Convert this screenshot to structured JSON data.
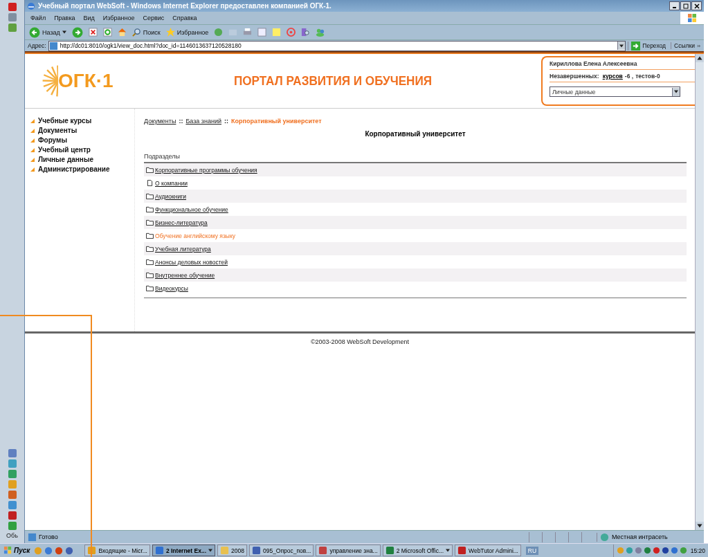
{
  "window": {
    "title": "Учебный портал WebSoft - Windows Internet Explorer предоставлен компанией  ОГК-1."
  },
  "menu": [
    "Файл",
    "Правка",
    "Вид",
    "Избранное",
    "Сервис",
    "Справка"
  ],
  "toolbar": {
    "back": "Назад",
    "search": "Поиск",
    "favorites": "Избранное"
  },
  "address": {
    "label": "Адрес:",
    "value": "http://dc01:8010/ogk1/view_doc.html?doc_id=1146013637120528180",
    "go": "Переход",
    "links": "Ссылки"
  },
  "header": {
    "title": "ПОРТАЛ РАЗВИТИЯ И ОБУЧЕНИЯ",
    "user": "Кириллова Елена Алексеевна",
    "pending_label": "Незавершенных:",
    "courses_link": "курсов",
    "courses_count": "-6 ,",
    "tests": "тестов-0",
    "select": "Личные данные"
  },
  "sidebar": {
    "items": [
      "Учебные курсы",
      "Документы",
      "Форумы",
      "Учебный центр",
      "Личные данные",
      "Администрирование"
    ]
  },
  "logo_text": "ОГК·1",
  "breadcrumb": [
    {
      "label": "Документы",
      "current": false
    },
    {
      "separator": "::",
      "label": "База знаний",
      "current": false
    },
    {
      "separator": "::",
      "label": "Корпоративный университет",
      "current": true
    }
  ],
  "page_title": "Корпоративный университет",
  "section_label": "Подразделы",
  "subsections": [
    {
      "label": "Корпоративные программы обучения",
      "kind": "folder",
      "highlighted": false
    },
    {
      "label": "О компании",
      "kind": "document",
      "highlighted": false
    },
    {
      "label": "Аудиокниги",
      "kind": "folder",
      "highlighted": false
    },
    {
      "label": "Функциональное обучение",
      "kind": "folder",
      "highlighted": false
    },
    {
      "label": "Бизнес-литература",
      "kind": "folder",
      "highlighted": false
    },
    {
      "label": "Обучение английскому языку",
      "kind": "folder",
      "highlighted": true
    },
    {
      "label": "Учебная литература",
      "kind": "folder",
      "highlighted": false
    },
    {
      "label": "Анонсы деловых новостей",
      "kind": "folder",
      "highlighted": false
    },
    {
      "label": "Внутреннее обучение",
      "kind": "folder",
      "highlighted": false
    },
    {
      "label": "Видеокурсы",
      "kind": "folder",
      "highlighted": false
    }
  ],
  "footer": "©2003-2008 WebSoft Development",
  "status_bar": {
    "text": "Готово",
    "zone": "Местная интрасеть"
  },
  "desktop_label": "Обь",
  "taskbar": {
    "start": "Пуск",
    "tasks": [
      {
        "label": "Входящие - Micr...",
        "selected": false,
        "menu": false
      },
      {
        "label": "2 Internet Ex...",
        "selected": true,
        "menu": true
      },
      {
        "label": "2008",
        "selected": false,
        "menu": false
      },
      {
        "label": "095_Опрос_пов...",
        "selected": false,
        "menu": false
      },
      {
        "label": "управление зна...",
        "selected": false,
        "menu": false
      },
      {
        "label": "2 Microsoft Offic...",
        "selected": false,
        "menu": true
      },
      {
        "label": "WebTutor Admini...",
        "selected": false,
        "menu": false
      }
    ],
    "language": "RU",
    "clock": "15:20"
  }
}
